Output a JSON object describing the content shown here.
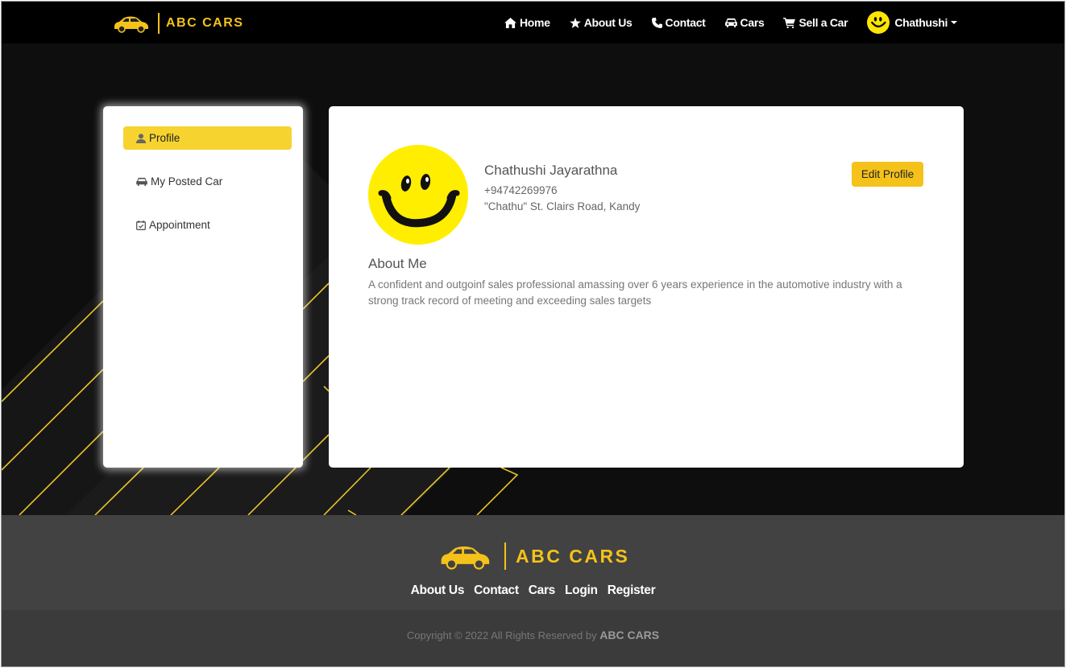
{
  "brand": {
    "name": "ABC CARS"
  },
  "nav": {
    "items": [
      {
        "label": "Home",
        "icon": "home-icon"
      },
      {
        "label": "About Us",
        "icon": "star-icon"
      },
      {
        "label": "Contact",
        "icon": "phone-icon"
      },
      {
        "label": "Cars",
        "icon": "car-icon"
      },
      {
        "label": "Sell a Car",
        "icon": "cart-icon"
      }
    ],
    "user": "Chathushi"
  },
  "sidebar": {
    "items": [
      {
        "label": "Profile",
        "icon": "user-icon",
        "active": true
      },
      {
        "label": "My Posted Car",
        "icon": "car-icon"
      },
      {
        "label": "Appointment",
        "icon": "calendar-check-icon"
      }
    ]
  },
  "profile": {
    "name": "Chathushi Jayarathna",
    "phone": "+94742269976",
    "address": "\"Chathu\" St. Clairs Road, Kandy",
    "edit_label": "Edit Profile",
    "about_title": "About Me",
    "about_text": "A confident and outgoinf sales professional amassing over 6 years experience in the automotive industry with a strong track record of meeting and exceeding sales targets"
  },
  "footer": {
    "brand": "ABC CARS",
    "links": [
      "About Us",
      "Contact",
      "Cars",
      "Login",
      "Register"
    ],
    "copyright_prefix": "Copyright © 2022 All Rights Reserved by ",
    "copyright_brand": "ABC CARS"
  },
  "colors": {
    "accent": "#f4c21a",
    "navbar": "#000000",
    "footer": "#424242",
    "active_item": "#f6d32f"
  }
}
